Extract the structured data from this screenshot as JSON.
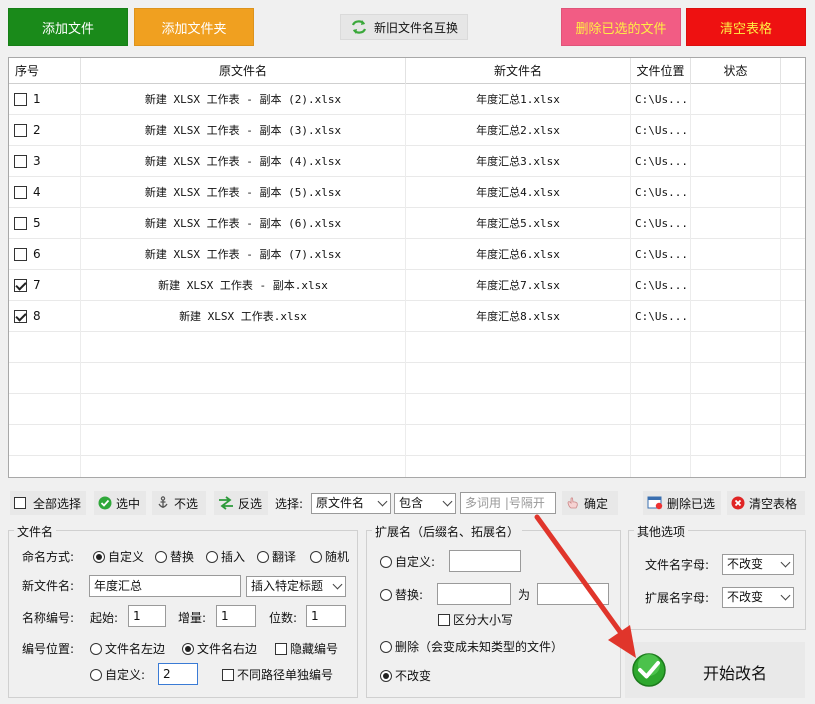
{
  "colors": {
    "add_file": "#1a8a1a",
    "add_folder": "#f0a020",
    "delete_selected": "#f25c84",
    "clear_table": "#ee1111",
    "delete_selected_text": "#ffee44",
    "clear_table_text": "#ffee44"
  },
  "top_buttons": {
    "add_file": "添加文件",
    "add_folder": "添加文件夹",
    "swap_names": "新旧文件名互换",
    "delete_selected": "删除已选的文件",
    "clear_table": "清空表格"
  },
  "table": {
    "columns": [
      "序号",
      "原文件名",
      "新文件名",
      "文件位置",
      "状态"
    ],
    "rows": [
      {
        "checked": false,
        "index": "1",
        "original": "新建 XLSX 工作表 - 副本 (2).xlsx",
        "new": "年度汇总1.xlsx",
        "location": "C:\\Us...",
        "status": ""
      },
      {
        "checked": false,
        "index": "2",
        "original": "新建 XLSX 工作表 - 副本 (3).xlsx",
        "new": "年度汇总2.xlsx",
        "location": "C:\\Us...",
        "status": ""
      },
      {
        "checked": false,
        "index": "3",
        "original": "新建 XLSX 工作表 - 副本 (4).xlsx",
        "new": "年度汇总3.xlsx",
        "location": "C:\\Us...",
        "status": ""
      },
      {
        "checked": false,
        "index": "4",
        "original": "新建 XLSX 工作表 - 副本 (5).xlsx",
        "new": "年度汇总4.xlsx",
        "location": "C:\\Us...",
        "status": ""
      },
      {
        "checked": false,
        "index": "5",
        "original": "新建 XLSX 工作表 - 副本 (6).xlsx",
        "new": "年度汇总5.xlsx",
        "location": "C:\\Us...",
        "status": ""
      },
      {
        "checked": false,
        "index": "6",
        "original": "新建 XLSX 工作表 - 副本 (7).xlsx",
        "new": "年度汇总6.xlsx",
        "location": "C:\\Us...",
        "status": ""
      },
      {
        "checked": true,
        "index": "7",
        "original": "新建 XLSX 工作表 - 副本.xlsx",
        "new": "年度汇总7.xlsx",
        "location": "C:\\Us...",
        "status": ""
      },
      {
        "checked": true,
        "index": "8",
        "original": "新建 XLSX 工作表.xlsx",
        "new": "年度汇总8.xlsx",
        "location": "C:\\Us...",
        "status": ""
      }
    ]
  },
  "toolbar": {
    "select_all": "全部选择",
    "select": "选中",
    "deselect": "不选",
    "invert": "反选",
    "filter_label": "选择:",
    "filter_field": "原文件名",
    "filter_op": "包含",
    "filter_placeholder": "多词用 |号隔开",
    "confirm": "确定",
    "delete_selected": "删除已选",
    "clear_table": "清空表格"
  },
  "filename_panel": {
    "title": "文件名",
    "naming_label": "命名方式:",
    "modes": [
      "自定义",
      "替换",
      "插入",
      "翻译",
      "随机"
    ],
    "selected_mode": 0,
    "new_name_label": "新文件名:",
    "new_name_value": "年度汇总",
    "insert_title": "插入特定标题",
    "numbering_label": "名称编号:",
    "start_label": "起始:",
    "start_value": "1",
    "step_label": "增量:",
    "step_value": "1",
    "digits_label": "位数:",
    "digits_value": "1",
    "position_label": "编号位置:",
    "position_left": "文件名左边",
    "position_right": "文件名右边",
    "hide_number": "隐藏编号",
    "custom_label": "自定义:",
    "custom_value": "2",
    "separate_numbering": "不同路径单独编号"
  },
  "ext_panel": {
    "title": "扩展名（后缀名、拓展名）",
    "custom": "自定义:",
    "replace": "替换:",
    "to": "为",
    "case_sensitive": "区分大小写",
    "delete": "删除（会变成未知类型的文件）",
    "no_change": "不改变"
  },
  "other_panel": {
    "title": "其他选项",
    "filename_case_label": "文件名字母:",
    "filename_case_value": "不改变",
    "ext_case_label": "扩展名字母:",
    "ext_case_value": "不改变"
  },
  "start_button": "开始改名"
}
